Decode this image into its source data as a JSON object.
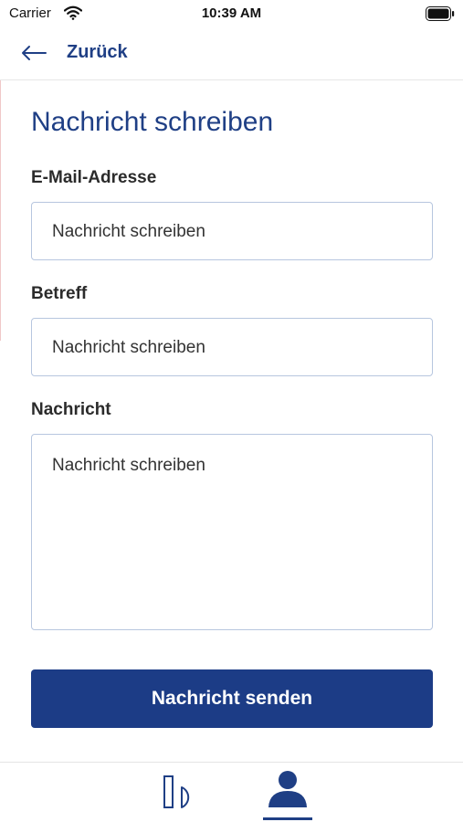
{
  "status_bar": {
    "carrier": "Carrier",
    "time": "10:39 AM"
  },
  "nav": {
    "back_label": "Zurück"
  },
  "form": {
    "title": "Nachricht schreiben",
    "fields": [
      {
        "label": "E-Mail-Adresse",
        "placeholder": "Nachricht schreiben"
      },
      {
        "label": "Betreff",
        "placeholder": "Nachricht schreiben"
      },
      {
        "label": "Nachricht",
        "placeholder": "Nachricht schreiben"
      }
    ],
    "submit_label": "Nachricht senden"
  },
  "tabbar": {
    "tabs": [
      {
        "icon": "document-icon",
        "active": false
      },
      {
        "icon": "user-icon",
        "active": true
      }
    ]
  },
  "colors": {
    "primary": "#1c3c86",
    "title": "#1f3f85",
    "field_border": "#b7c6df"
  }
}
